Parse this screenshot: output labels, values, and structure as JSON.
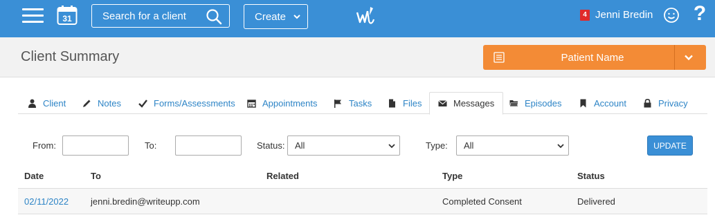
{
  "topbar": {
    "calendar_day": "31",
    "search_placeholder": "Search for a client",
    "create_label": "Create",
    "user_name": "Jenni Bredin",
    "notification_count": "4",
    "help_label": "?"
  },
  "header": {
    "page_title": "Client Summary",
    "patient_label": "Patient Name"
  },
  "tabs": [
    {
      "label": "Client",
      "icon": "user-icon"
    },
    {
      "label": "Notes",
      "icon": "pencil-icon"
    },
    {
      "label": "Forms/Assessments",
      "icon": "checkmark-icon"
    },
    {
      "label": "Appointments",
      "icon": "calendar-icon"
    },
    {
      "label": "Tasks",
      "icon": "flag-icon"
    },
    {
      "label": "Files",
      "icon": "file-icon"
    },
    {
      "label": "Messages",
      "icon": "envelope-icon",
      "active": true
    },
    {
      "label": "Episodes",
      "icon": "folder-icon"
    },
    {
      "label": "Account",
      "icon": "bookmark-icon"
    },
    {
      "label": "Privacy",
      "icon": "lock-icon"
    }
  ],
  "filters": {
    "from_label": "From:",
    "from_value": "",
    "to_label": "To:",
    "to_value": "",
    "status_label": "Status:",
    "status_value": "All",
    "type_label": "Type:",
    "type_value": "All",
    "update_label": "UPDATE"
  },
  "table": {
    "columns": [
      "Date",
      "To",
      "Related",
      "Type",
      "Status"
    ],
    "rows": [
      {
        "date": "02/11/2022",
        "to": "jenni.bredin@writeupp.com",
        "related": "",
        "type": "Completed Consent",
        "status": "Delivered"
      }
    ]
  },
  "colors": {
    "topbar": "#3a8fd6",
    "patient_button": "#f38b36",
    "link": "#2d84c6",
    "badge": "#e02a2a"
  }
}
